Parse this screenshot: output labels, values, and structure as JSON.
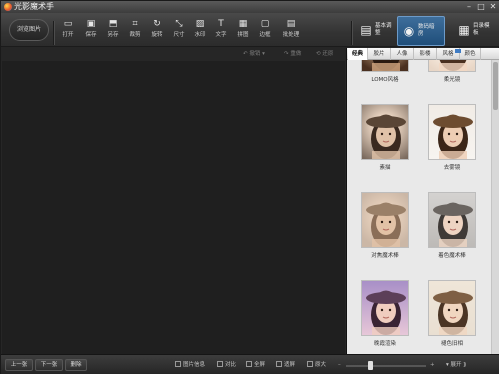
{
  "window": {
    "title": "光影魔术手",
    "minimize": "–",
    "maximize": "□",
    "close": "✕"
  },
  "toolbar": {
    "browse_label": "浏览图片",
    "tools": [
      {
        "label": "打开",
        "icon": "folder-icon",
        "glyph": "▭"
      },
      {
        "label": "保存",
        "icon": "save-icon",
        "glyph": "▣"
      },
      {
        "label": "另存",
        "icon": "save-as-icon",
        "glyph": "⬒"
      },
      {
        "label": "裁剪",
        "icon": "crop-icon",
        "glyph": "⌗"
      },
      {
        "label": "旋转",
        "icon": "rotate-icon",
        "glyph": "↻"
      },
      {
        "label": "尺寸",
        "icon": "resize-icon",
        "glyph": "⤡"
      },
      {
        "label": "水印",
        "icon": "watermark-icon",
        "glyph": "▨"
      },
      {
        "label": "文字",
        "icon": "text-icon",
        "glyph": "T"
      },
      {
        "label": "拼图",
        "icon": "collage-icon",
        "glyph": "▦"
      },
      {
        "label": "边框",
        "icon": "frame-icon",
        "glyph": "▢"
      },
      {
        "label": "批处理",
        "icon": "batch-icon",
        "glyph": "▤"
      }
    ],
    "right_tools": [
      {
        "label": "基本调整",
        "icon": "adjust-icon",
        "glyph": "▤"
      },
      {
        "label": "数码暗房",
        "icon": "camera-icon",
        "glyph": "◉"
      },
      {
        "label": "目录模板",
        "icon": "template-icon",
        "glyph": "▦"
      }
    ]
  },
  "canvas": {
    "undo": "撤销",
    "redo": "重做",
    "restore": "还原"
  },
  "panel": {
    "tabs": [
      "经典",
      "胶片",
      "人像",
      "影楼",
      "风格",
      "颜色"
    ],
    "active_tab": 0,
    "effects": [
      {
        "label": "LOMO风格",
        "tone": "lomo"
      },
      {
        "label": "柔光镜",
        "tone": "soft"
      },
      {
        "label": "素描",
        "tone": "sketch"
      },
      {
        "label": "去雾镜",
        "tone": "clear"
      },
      {
        "label": "对焦魔术棒",
        "tone": "blur"
      },
      {
        "label": "着色魔术棒",
        "tone": "tint"
      },
      {
        "label": "晚霞渲染",
        "tone": "sunset"
      },
      {
        "label": "褪色旧相",
        "tone": "fade"
      }
    ]
  },
  "statusbar": {
    "prev": "上一张",
    "next": "下一张",
    "delete": "删除",
    "info": "图片信息",
    "compare": "对比",
    "fullscreen": "全屏",
    "fit": "适屏",
    "original": "原大",
    "expand": "展开",
    "zoom": 0.3
  }
}
